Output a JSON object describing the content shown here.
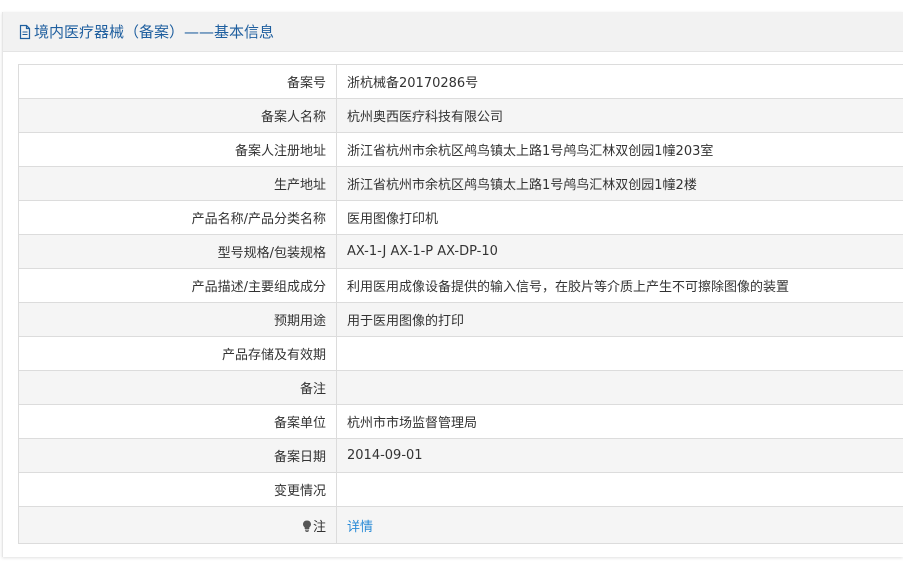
{
  "header": {
    "title": "境内医疗器械（备案）——基本信息",
    "icon": "document-icon"
  },
  "colors": {
    "header_text": "#1f5f9f",
    "link": "#2a8bd6",
    "stripe": "#f5f5f5",
    "border": "#dcdcdc"
  },
  "rows": [
    {
      "label": "备案号",
      "value": "浙杭械备20170286号"
    },
    {
      "label": "备案人名称",
      "value": "杭州奥西医疗科技有限公司"
    },
    {
      "label": "备案人注册地址",
      "value": "浙江省杭州市余杭区鸬鸟镇太上路1号鸬鸟汇林双创园1幢203室"
    },
    {
      "label": "生产地址",
      "value": "浙江省杭州市余杭区鸬鸟镇太上路1号鸬鸟汇林双创园1幢2楼"
    },
    {
      "label": "产品名称/产品分类名称",
      "value": "医用图像打印机"
    },
    {
      "label": "型号规格/包装规格",
      "value": "AX-1-J AX-1-P AX-DP-10"
    },
    {
      "label": "产品描述/主要组成成分",
      "value": "利用医用成像设备提供的输入信号，在胶片等介质上产生不可擦除图像的装置"
    },
    {
      "label": "预期用途",
      "value": "用于医用图像的打印"
    },
    {
      "label": "产品存储及有效期",
      "value": ""
    },
    {
      "label": "备注",
      "value": ""
    },
    {
      "label": "备案单位",
      "value": "杭州市市场监督管理局"
    },
    {
      "label": "备案日期",
      "value": "2014-09-01"
    },
    {
      "label": "变更情况",
      "value": ""
    }
  ],
  "note_row": {
    "label": "注",
    "icon": "lightbulb-icon",
    "link_text": "详情"
  }
}
